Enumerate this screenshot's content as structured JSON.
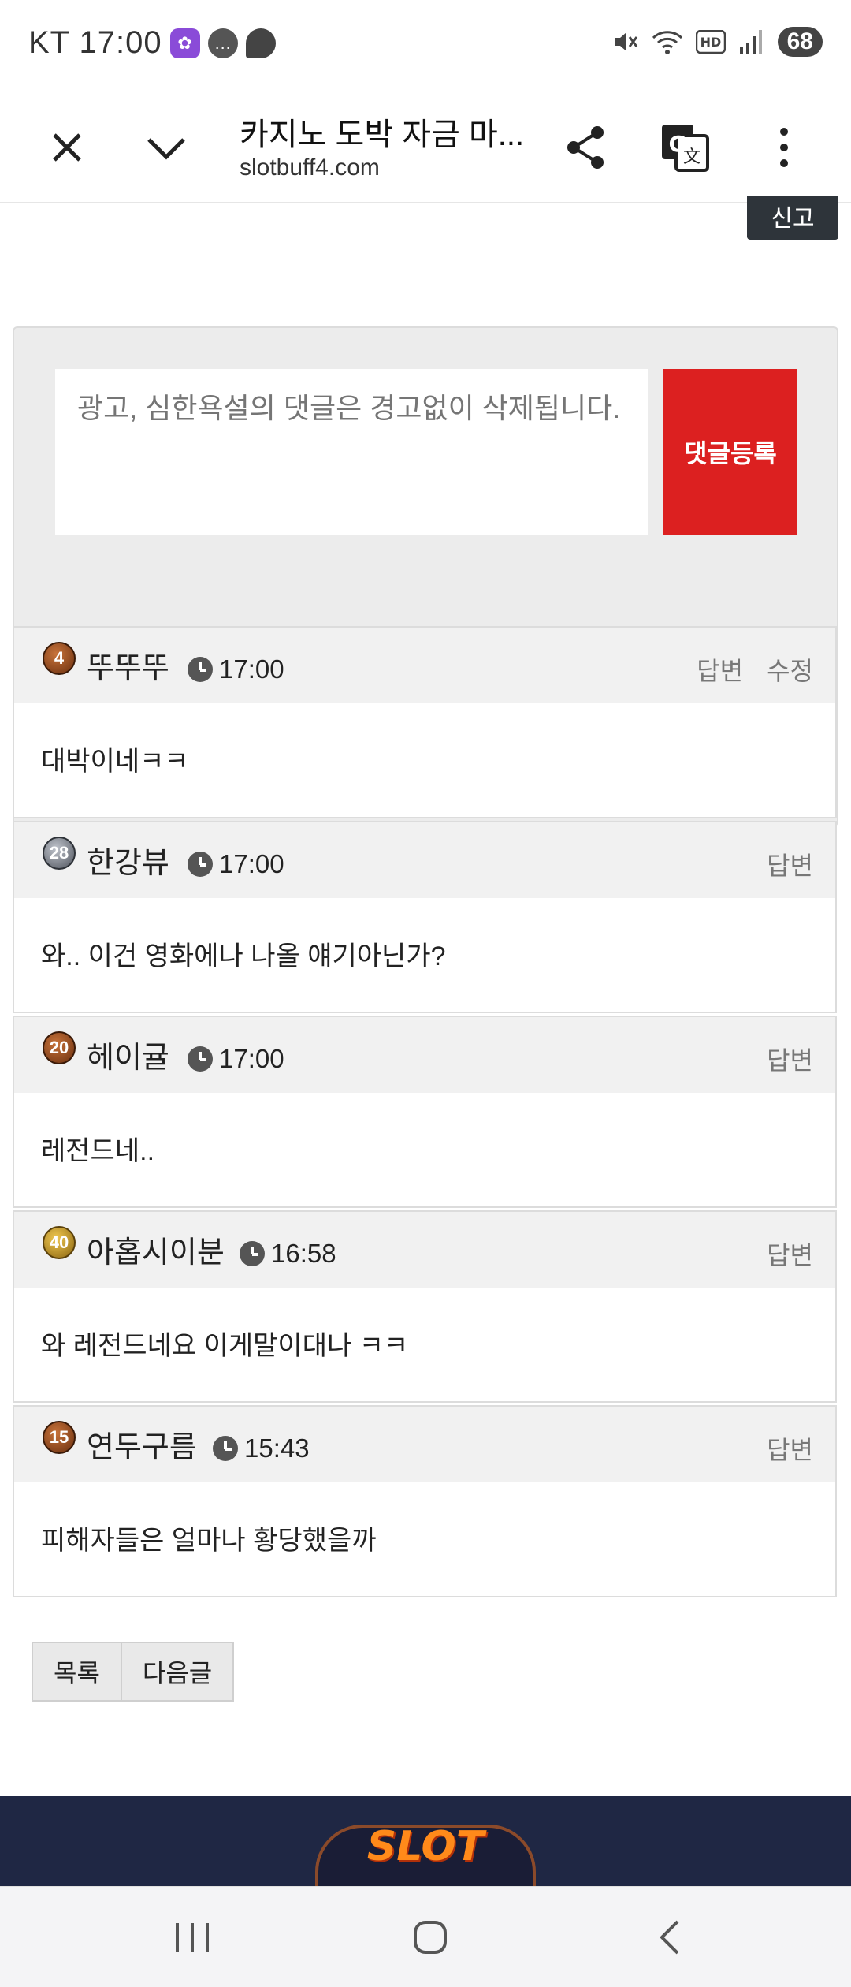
{
  "status_bar": {
    "carrier_time": "KT 17:00",
    "battery": "68"
  },
  "browser": {
    "title": "카지노 도박 자금 마...",
    "url": "slotbuff4.com"
  },
  "page": {
    "report_label": "신고",
    "comment_placeholder": "광고, 심한욕설의 댓글은 경고없이 삭제됩니다.",
    "submit_label": "댓글등록",
    "comments": [
      {
        "level": "4",
        "name": "뚜뚜뚜",
        "time": "17:00",
        "actions": [
          "답변",
          "수정"
        ],
        "body": "대박이네ㅋㅋ"
      },
      {
        "level": "28",
        "name": "한강뷰",
        "time": "17:00",
        "actions": [
          "답변"
        ],
        "body": "와.. 이건 영화에나 나올 얘기아닌가?"
      },
      {
        "level": "20",
        "name": "헤이귤",
        "time": "17:00",
        "actions": [
          "답변"
        ],
        "body": "레전드네.."
      },
      {
        "level": "40",
        "name": "아홉시이분",
        "time": "16:58",
        "actions": [
          "답변"
        ],
        "body": "와 레전드네요 이게말이대나 ㅋㅋ"
      },
      {
        "level": "15",
        "name": "연두구름",
        "time": "15:43",
        "actions": [
          "답변"
        ],
        "body": "피해자들은 얼마나 황당했을까"
      }
    ],
    "list_label": "목록",
    "next_label": "다음글",
    "footer_logo": "SLOT"
  }
}
